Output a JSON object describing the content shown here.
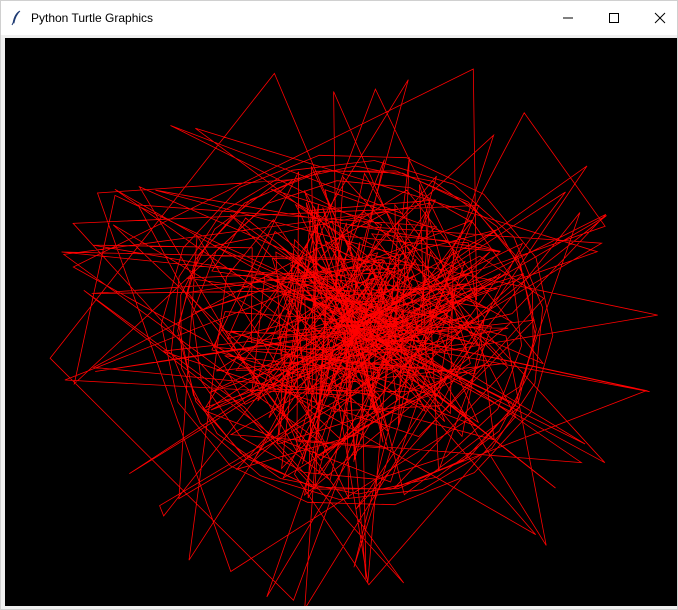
{
  "window": {
    "title": "Python Turtle Graphics"
  },
  "controls": {
    "minimize_icon": "minimize-icon",
    "maximize_icon": "maximize-icon",
    "close_icon": "close-icon"
  },
  "canvas": {
    "background": "#000000",
    "pen_color": "#ff0000"
  },
  "colors": {
    "titlebar_bg": "#ffffff",
    "window_bg": "#f0f0f0",
    "pen": "#ff0000"
  }
}
